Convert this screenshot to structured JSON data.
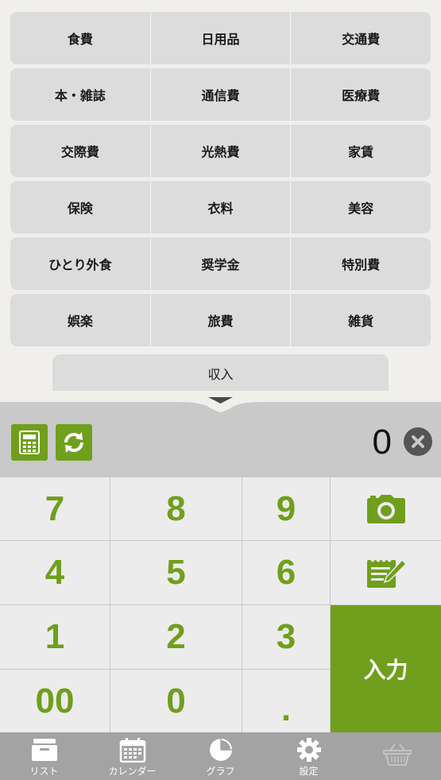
{
  "categories": {
    "rows": [
      [
        "食費",
        "日用品",
        "交通費"
      ],
      [
        "本・雑誌",
        "通信費",
        "医療費"
      ],
      [
        "交際費",
        "光熱費",
        "家賃"
      ],
      [
        "保険",
        "衣料",
        "美容"
      ],
      [
        "ひとり外食",
        "奨学金",
        "特別費"
      ],
      [
        "娯楽",
        "旅費",
        "雑貨"
      ]
    ],
    "income_tab": "収入"
  },
  "display": {
    "amount": "0",
    "tools": [
      "calculator-icon",
      "refresh-icon"
    ],
    "clear_icon": "clear-icon"
  },
  "keypad": {
    "k7": "7",
    "k8": "8",
    "k9": "9",
    "k4": "4",
    "k5": "5",
    "k6": "6",
    "k1": "1",
    "k2": "2",
    "k3": "3",
    "k00": "00",
    "k0": "0",
    "kdot": ".",
    "enter": "入力",
    "side_icons": [
      "camera-icon",
      "memo-icon"
    ]
  },
  "colors": {
    "accent": "#6f9f1c",
    "key_bg": "#ececec",
    "display_bg": "#c9c9c9",
    "tabbar_bg": "#a3a3a3"
  },
  "tabbar": {
    "list": "リスト",
    "calendar": "カレンダー",
    "graph": "グラフ",
    "settings": "設定"
  }
}
